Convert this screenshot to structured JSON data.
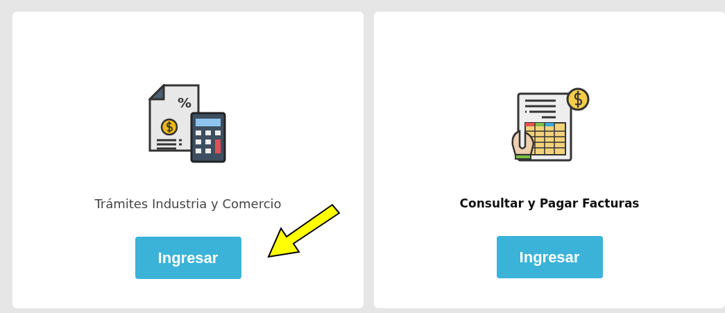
{
  "cards": [
    {
      "kind": "calculator",
      "icon_symbol": "%",
      "title": "Trámites Industria y Comercio",
      "bold": false,
      "button": "Ingresar",
      "pointer": true
    },
    {
      "kind": "invoice",
      "title": "Consultar y Pagar Facturas",
      "bold": true,
      "button": "Ingresar",
      "pointer": false
    }
  ]
}
